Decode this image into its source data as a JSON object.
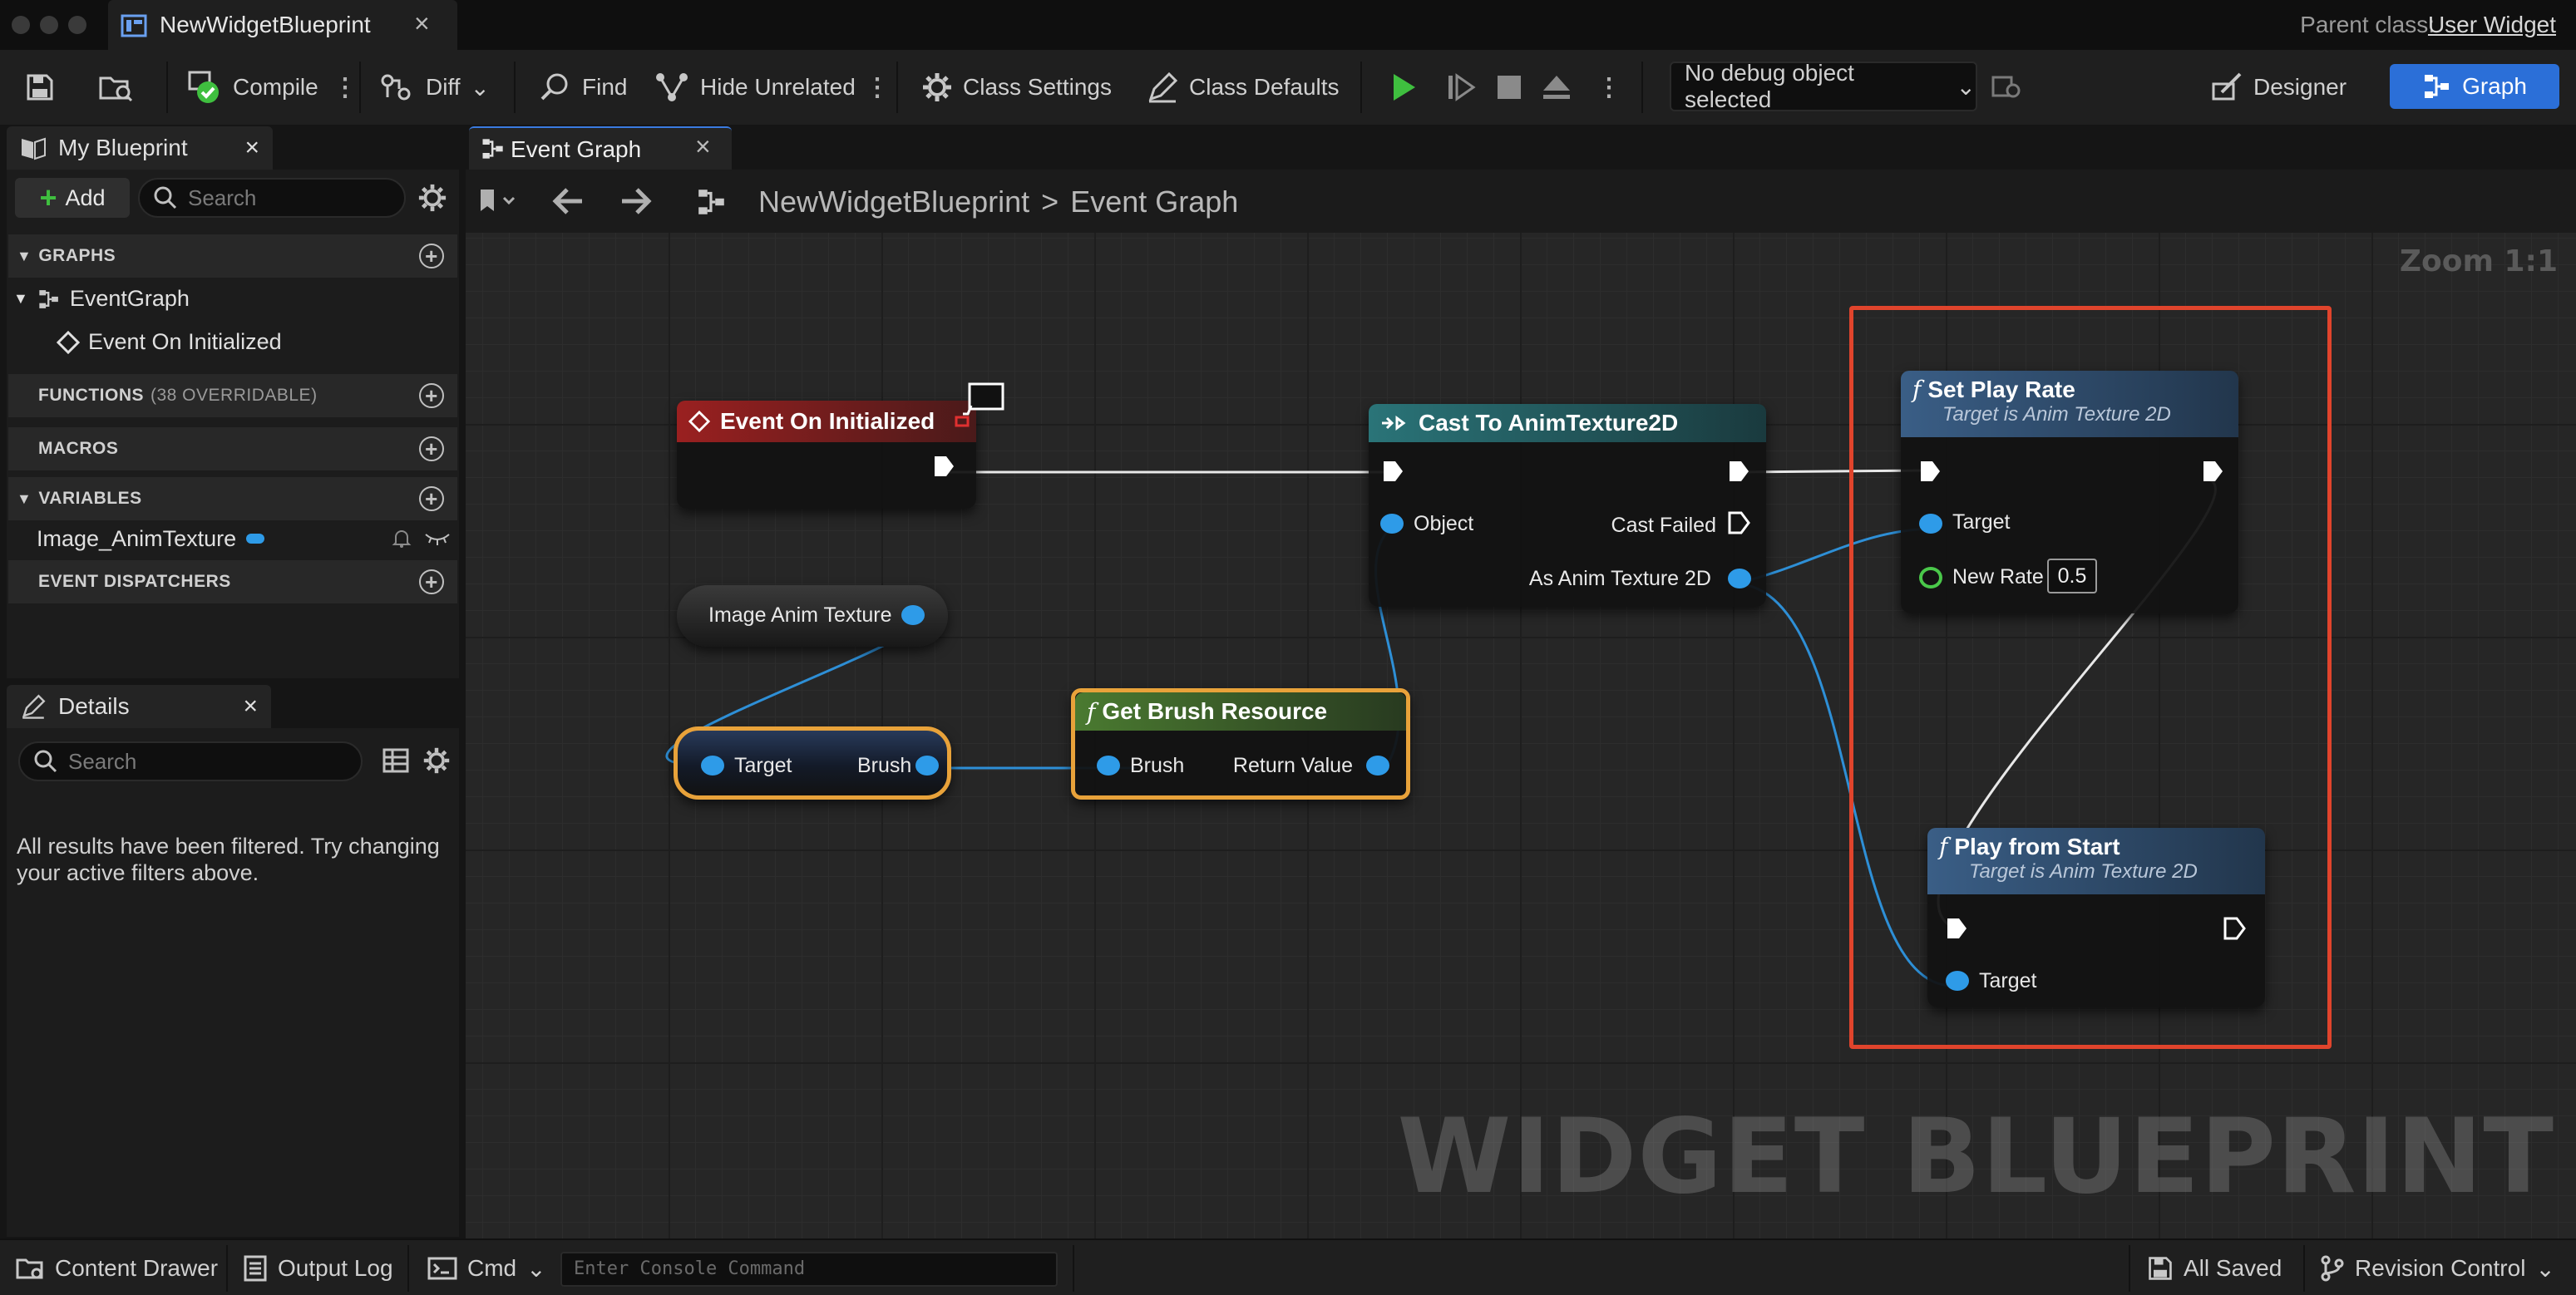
{
  "window": {
    "tab_title": "NewWidgetBlueprint",
    "parent_class_label": "Parent class:",
    "parent_class_value": "User Widget"
  },
  "toolbar": {
    "compile": "Compile",
    "diff": "Diff",
    "find": "Find",
    "hide_unrelated": "Hide Unrelated",
    "class_settings": "Class Settings",
    "class_defaults": "Class Defaults",
    "debug_object": "No debug object selected",
    "designer": "Designer",
    "graph": "Graph",
    "accent_color": "#2b6fd8",
    "play_color": "#3fbf3f"
  },
  "my_blueprint": {
    "title": "My Blueprint",
    "add": "Add",
    "search_placeholder": "Search",
    "sections": {
      "graphs": "GRAPHS",
      "functions": "FUNCTIONS",
      "functions_count": "(38 OVERRIDABLE)",
      "macros": "MACROS",
      "variables": "VARIABLES",
      "event_dispatchers": "EVENT DISPATCHERS"
    },
    "event_graph": "EventGraph",
    "event_item": "Event On Initialized",
    "variable": "Image_AnimTexture"
  },
  "details": {
    "title": "Details",
    "search_placeholder": "Search",
    "filtered_message": "All results have been filtered. Try changing your active filters above."
  },
  "graph_editor": {
    "tab": "Event Graph",
    "breadcrumb_root": "NewWidgetBlueprint",
    "breadcrumb_separator": ">",
    "breadcrumb_current": "Event Graph",
    "zoom": "Zoom 1:1",
    "watermark": "WIDGET BLUEPRINT",
    "nodes": {
      "event": {
        "title": "Event On Initialized",
        "color": "#8a1d1d"
      },
      "cast": {
        "title": "Cast To AnimTexture2D",
        "object_pin": "Object",
        "failed_pin": "Cast Failed",
        "out_pin": "As Anim Texture 2D",
        "color": "#1f5c5e"
      },
      "var_get": {
        "label": "Image Anim Texture"
      },
      "break": {
        "target": "Target",
        "brush": "Brush"
      },
      "get_brush": {
        "title": "Get Brush Resource",
        "brush_pin": "Brush",
        "return_pin": "Return Value",
        "color": "#3d5e2a"
      },
      "set_rate": {
        "title": "Set Play Rate",
        "subtitle": "Target is Anim Texture 2D",
        "target_pin": "Target",
        "rate_pin": "New Rate",
        "rate_value": "0.5",
        "color": "#2d4a68"
      },
      "play": {
        "title": "Play from Start",
        "subtitle": "Target is Anim Texture 2D",
        "target_pin": "Target",
        "color": "#2d4a68"
      }
    },
    "highlight_color": "#e0442c"
  },
  "statusbar": {
    "content_drawer": "Content Drawer",
    "output_log": "Output Log",
    "cmd": "Cmd",
    "console_placeholder": "Enter Console Command",
    "all_saved": "All Saved",
    "revision_control": "Revision Control"
  }
}
